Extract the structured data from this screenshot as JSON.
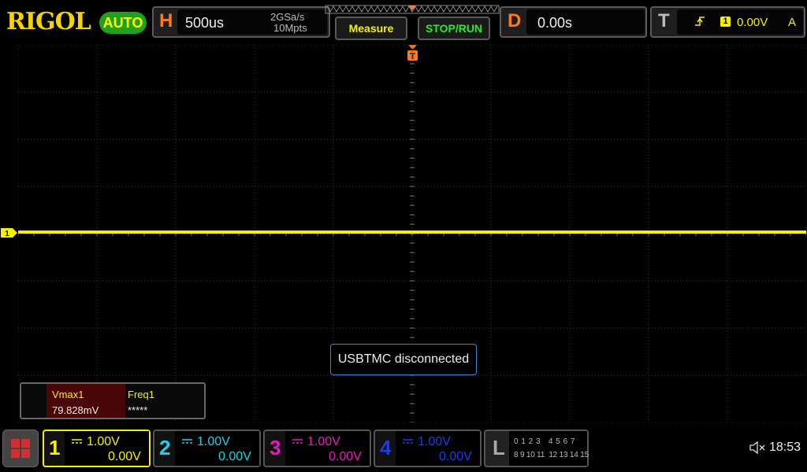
{
  "header": {
    "brand": "RIGOL",
    "mode": "AUTO",
    "horizontal": {
      "letter": "H",
      "timebase": "500us",
      "sample_rate": "2GSa/s",
      "memory_depth": "10Mpts"
    },
    "measure_label": "Measure",
    "stoprun_label": "STOP/RUN",
    "delay": {
      "letter": "D",
      "value": "0.00s"
    },
    "trigger": {
      "letter": "T",
      "source": "1",
      "level": "0.00V",
      "sweep": "A"
    }
  },
  "waveform": {
    "channel_marker": "1",
    "trigger_marker": "T",
    "trace_level_div": 0.0
  },
  "message": "USBTMC disconnected",
  "measurements": [
    {
      "name": "Vmax1",
      "value": "79.828mV"
    },
    {
      "name": "Freq1",
      "value": "*****"
    }
  ],
  "channels": [
    {
      "num": "1",
      "scale": "1.00V",
      "offset": "0.00V",
      "color": "#f5f000"
    },
    {
      "num": "2",
      "scale": "1.00V",
      "offset": "0.00V",
      "color": "#19d3e6"
    },
    {
      "num": "3",
      "scale": "1.00V",
      "offset": "0.00V",
      "color": "#e619c0"
    },
    {
      "num": "4",
      "scale": "1.00V",
      "offset": "0.00V",
      "color": "#1a3cf0"
    }
  ],
  "logic": {
    "letter": "L",
    "row1": "0 1 2 3   4 5 6 7",
    "row2": "8 9 10 11  12 13 14 15"
  },
  "status": {
    "time": "18:53",
    "sound_icon": "speaker-muted-icon"
  },
  "colors": {
    "accent": "#ff7a1a",
    "trace": "#f5f000",
    "grid": "#3a3a3a",
    "mode_bg": "#1fa01f"
  }
}
